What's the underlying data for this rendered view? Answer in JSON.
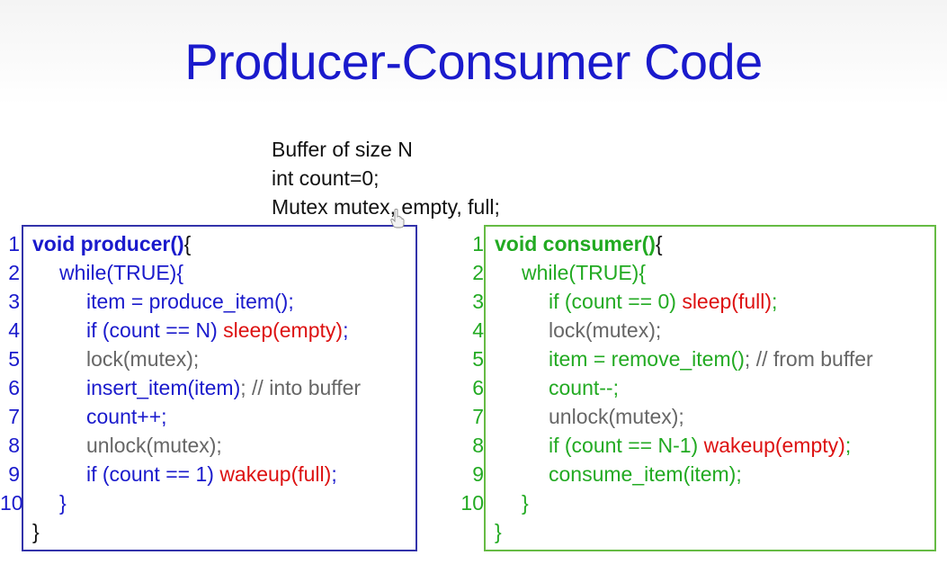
{
  "title": "Producer-Consumer Code",
  "globals": [
    "Buffer of size N",
    "int count=0;",
    "Mutex mutex, empty, full;"
  ],
  "colors": {
    "title": "#1a1acc",
    "producer_border": "#3333aa",
    "consumer_border": "#66bb44",
    "blue": "#1a1acc",
    "green": "#22aa22",
    "red": "#dd1111",
    "gray": "#666666"
  },
  "producer": {
    "lines": [
      {
        "num": "1",
        "indent": 0,
        "tokens": [
          {
            "text": "void producer()",
            "color": "blue",
            "bold": true
          },
          {
            "text": "{",
            "color": "black",
            "bold": false
          }
        ]
      },
      {
        "num": "2",
        "indent": 1,
        "tokens": [
          {
            "text": "while(TRUE){",
            "color": "blue",
            "bold": false
          }
        ]
      },
      {
        "num": "3",
        "indent": 2,
        "tokens": [
          {
            "text": "item = produce_item();",
            "color": "blue",
            "bold": false
          }
        ]
      },
      {
        "num": "4",
        "indent": 2,
        "tokens": [
          {
            "text": "if (count == N) ",
            "color": "blue",
            "bold": false
          },
          {
            "text": "sleep(empty)",
            "color": "red",
            "bold": false
          },
          {
            "text": ";",
            "color": "blue",
            "bold": false
          }
        ]
      },
      {
        "num": "5",
        "indent": 2,
        "tokens": [
          {
            "text": "lock(mutex);",
            "color": "gray",
            "bold": false
          }
        ]
      },
      {
        "num": "6",
        "indent": 2,
        "tokens": [
          {
            "text": "insert_item(item)",
            "color": "blue",
            "bold": false
          },
          {
            "text": "; // into buffer",
            "color": "gray",
            "bold": false
          }
        ]
      },
      {
        "num": "7",
        "indent": 2,
        "tokens": [
          {
            "text": "count++;",
            "color": "blue",
            "bold": false
          }
        ]
      },
      {
        "num": "8",
        "indent": 2,
        "tokens": [
          {
            "text": "unlock(mutex);",
            "color": "gray",
            "bold": false
          }
        ]
      },
      {
        "num": "9",
        "indent": 2,
        "tokens": [
          {
            "text": "if (count == 1) ",
            "color": "blue",
            "bold": false
          },
          {
            "text": "wakeup(full)",
            "color": "red",
            "bold": false
          },
          {
            "text": ";",
            "color": "blue",
            "bold": false
          }
        ]
      },
      {
        "num": "10",
        "indent": 1,
        "tokens": [
          {
            "text": "}",
            "color": "blue",
            "bold": false
          }
        ]
      },
      {
        "num": "",
        "indent": 0,
        "tokens": [
          {
            "text": "}",
            "color": "black",
            "bold": false
          }
        ]
      }
    ]
  },
  "consumer": {
    "lines": [
      {
        "num": "1",
        "indent": 0,
        "tokens": [
          {
            "text": "void consumer()",
            "color": "green",
            "bold": true
          },
          {
            "text": "{",
            "color": "black",
            "bold": false
          }
        ]
      },
      {
        "num": "2",
        "indent": 1,
        "tokens": [
          {
            "text": "while(TRUE){",
            "color": "green",
            "bold": false
          }
        ]
      },
      {
        "num": "3",
        "indent": 2,
        "tokens": [
          {
            "text": "if (count == 0) ",
            "color": "green",
            "bold": false
          },
          {
            "text": "sleep(full)",
            "color": "red",
            "bold": false
          },
          {
            "text": ";",
            "color": "green",
            "bold": false
          }
        ]
      },
      {
        "num": "4",
        "indent": 2,
        "tokens": [
          {
            "text": "lock(mutex);",
            "color": "gray",
            "bold": false
          }
        ]
      },
      {
        "num": "5",
        "indent": 2,
        "tokens": [
          {
            "text": "item = remove_item()",
            "color": "green",
            "bold": false
          },
          {
            "text": "; // from buffer",
            "color": "gray",
            "bold": false
          }
        ]
      },
      {
        "num": "6",
        "indent": 2,
        "tokens": [
          {
            "text": "count--;",
            "color": "green",
            "bold": false
          }
        ]
      },
      {
        "num": "7",
        "indent": 2,
        "tokens": [
          {
            "text": "unlock(mutex);",
            "color": "gray",
            "bold": false
          }
        ]
      },
      {
        "num": "8",
        "indent": 2,
        "tokens": [
          {
            "text": "if (count == N-1) ",
            "color": "green",
            "bold": false
          },
          {
            "text": "wakeup(empty)",
            "color": "red",
            "bold": false
          },
          {
            "text": ";",
            "color": "green",
            "bold": false
          }
        ]
      },
      {
        "num": "9",
        "indent": 2,
        "tokens": [
          {
            "text": "consume_item(item);",
            "color": "green",
            "bold": false
          }
        ]
      },
      {
        "num": "10",
        "indent": 1,
        "tokens": [
          {
            "text": "}",
            "color": "green",
            "bold": false
          }
        ]
      },
      {
        "num": "",
        "indent": 0,
        "tokens": [
          {
            "text": "}",
            "color": "green",
            "bold": false
          }
        ]
      }
    ]
  },
  "cursor_icon": "hand-pointer-icon"
}
